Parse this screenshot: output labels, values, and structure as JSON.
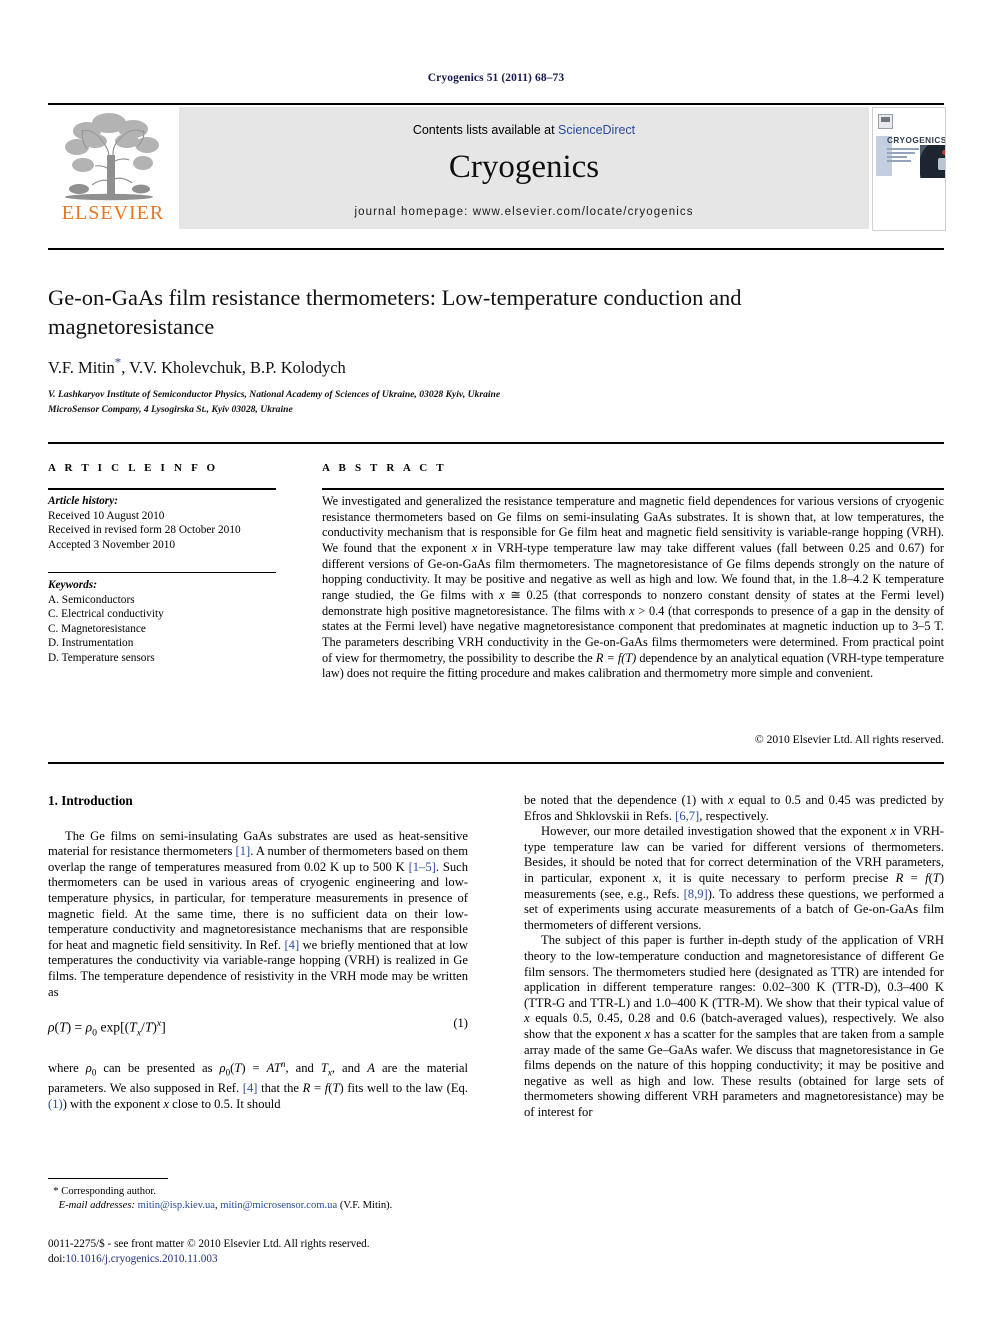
{
  "running_head": "Cryogenics 51 (2011) 68–73",
  "masthead": {
    "contents_prefix": "Contents lists available at ",
    "sciencedirect": "ScienceDirect",
    "journal_name": "Cryogenics",
    "homepage": "journal homepage: www.elsevier.com/locate/cryogenics",
    "publisher_logo_text": "ELSEVIER",
    "cover_title": "CRYOGENICS"
  },
  "article": {
    "title": "Ge-on-GaAs film resistance thermometers: Low-temperature conduction and magnetoresistance",
    "authors": "V.F. Mitin, V.V. Kholevchuk, B.P. Kolodych",
    "corresponding_marker": "*",
    "affiliations": [
      "V. Lashkaryov Institute of Semiconductor Physics, National Academy of Sciences of Ukraine, 03028 Kyiv, Ukraine",
      "MicroSensor Company, 4 Lysogirska St., Kyiv 03028, Ukraine"
    ]
  },
  "info": {
    "heading": "A R T I C L E   I N F O",
    "history_label": "Article history:",
    "history": [
      "Received 10 August 2010",
      "Received in revised form 28 October 2010",
      "Accepted 3 November 2010"
    ],
    "keywords_label": "Keywords:",
    "keywords": [
      "A. Semiconductors",
      "C. Electrical conductivity",
      "C. Magnetoresistance",
      "D. Instrumentation",
      "D. Temperature sensors"
    ]
  },
  "abstract": {
    "heading": "A B S T R A C T",
    "paragraph_1": "We investigated and generalized the resistance temperature and magnetic field dependences for various versions of cryogenic resistance thermometers based on Ge films on semi-insulating GaAs substrates. It is shown that, at low temperatures, the conductivity mechanism that is responsible for Ge film heat and magnetic field sensitivity is variable-range hopping (VRH). We found that the exponent ",
    "paragraph_2": " in VRH-type temperature law may take different values (fall between 0.25 and 0.67) for different versions of Ge-on-GaAs film thermometers. The magnetoresistance of Ge films depends strongly on the nature of hopping conductivity. It may be positive and negative as well as high and low. We found that, in the 1.8–4.2 K temperature range studied, the Ge films with ",
    "paragraph_3": " ≅ 0.25 (that corresponds to nonzero constant density of states at the Fermi level) demonstrate high positive magnetoresistance. The films with ",
    "paragraph_4": " > 0.4 (that corresponds to presence of a gap in the density of states at the Fermi level) have negative magnetoresistance component that predominates at magnetic induction up to 3–5 T. The parameters describing VRH conductivity in the Ge-on-GaAs films thermometers were determined. From practical point of view for thermometry, the possibility to describe the ",
    "paragraph_5": " dependence by an analytical equation (VRH-type temperature law) does not require the fitting procedure and makes calibration and thermometry more simple and convenient.",
    "var_x": "x",
    "rt_dependence": "R = f(T)",
    "copyright": "© 2010 Elsevier Ltd. All rights reserved."
  },
  "body": {
    "section_heading": "1. Introduction",
    "left": {
      "p1_a": "The Ge films on semi-insulating GaAs substrates are used as heat-sensitive material for resistance thermometers ",
      "p1_ref1": "[1]",
      "p1_b": ". A number of thermometers based on them overlap the range of temperatures measured from 0.02 K up to 500 K ",
      "p1_ref2": "[1–5]",
      "p1_c": ". Such thermometers can be used in various areas of cryogenic engineering and low-temperature physics, in particular, for temperature measurements in presence of magnetic field. At the same time, there is no sufficient data on their low-temperature conductivity and magnetoresistance mechanisms that are responsible for heat and magnetic field sensitivity. In Ref. ",
      "p1_ref3": "[4]",
      "p1_d": " we briefly mentioned that at low temperatures the conductivity via variable-range hopping (VRH) is realized in Ge films. The temperature dependence of resistivity in the VRH mode may be written as",
      "equation": "ρ(T) = ρ0 exp[(Tx/T)x]",
      "equation_number": "(1)",
      "p2_a": "where ",
      "p2_b": " can be presented as ",
      "p2_c": ", and ",
      "p2_d": ", and ",
      "p2_e": " are the material parameters. We also supposed in Ref. ",
      "p2_ref": "[4]",
      "p2_f": " that the ",
      "p2_g": " fits well to the law (Eq. ",
      "p2_eqref": "(1)",
      "p2_h": ") with the exponent ",
      "p2_i": " close to 0.5. It should"
    },
    "right": {
      "p1_a": "be noted that the dependence (1) with ",
      "p1_b": " equal to 0.5 and 0.45 was predicted by Efros and Shklovskii in Refs. ",
      "p1_ref": "[6,7]",
      "p1_c": ", respectively.",
      "p2_a": "However, our more detailed investigation showed that the exponent ",
      "p2_b": " in VRH-type temperature law can be varied for different versions of thermometers. Besides, it should be noted that for correct determination of the VRH parameters, in particular, exponent ",
      "p2_c": ", it is quite necessary to perform precise ",
      "p2_d": " measurements (see, e.g., Refs. ",
      "p2_ref": "[8,9]",
      "p2_e": "). To address these questions, we performed a set of experiments using accurate measurements of a batch of Ge-on-GaAs film thermometers of different versions.",
      "p3_a": "The subject of this paper is further in-depth study of the application of VRH theory to the low-temperature conduction and magnetoresistance of different Ge film sensors. The thermometers studied here (designated as TTR) are intended for application in different temperature ranges: 0.02–300 K (TTR-D), 0.3–400 K (TTR-G and TTR-L) and 1.0–400 K (TTR-M). We show that their typical value of ",
      "p3_b": " equals 0.5, 0.45, 0.28 and 0.6 (batch-averaged values), respectively. We also show that the exponent ",
      "p3_c": " has a scatter for the samples that are taken from a sample array made of the same Ge–GaAs wafer. We discuss that magnetoresistance in Ge films depends on the nature of this hopping conductivity; it may be positive and negative as well as high and low. These results (obtained for large sets of thermometers showing different VRH parameters and magnetoresistance) may be of interest for"
    }
  },
  "footer": {
    "corresponding_marker": "*",
    "corresponding_label": "Corresponding author.",
    "email_label": "E-mail addresses:",
    "email_1": "mitin@isp.kiev.ua",
    "email_2": "mitin@microsensor.com.ua",
    "email_suffix": "(V.F. Mitin).",
    "issn_line": "0011-2275/$ - see front matter © 2010 Elsevier Ltd. All rights reserved.",
    "doi_prefix": "doi:",
    "doi": "10.1016/j.cryogenics.2010.11.003"
  },
  "colors": {
    "link_blue": "#2a4b9b",
    "elsevier_orange": "#e87722",
    "band_gray": "#e6e6e6",
    "running_head_navy": "#17184b"
  }
}
